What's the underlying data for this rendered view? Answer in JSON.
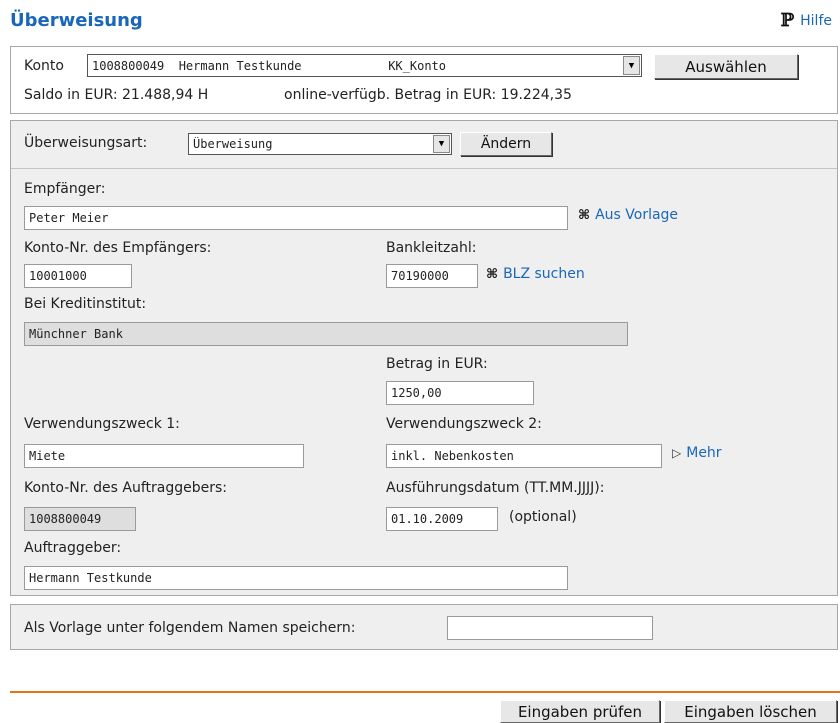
{
  "header": {
    "title": "Überweisung",
    "help_label": "Hilfe"
  },
  "account": {
    "label": "Konto",
    "selected": "1008800049  Hermann Testkunde            KK_Konto",
    "select_button": "Auswählen",
    "saldo": "Saldo in EUR:  21.488,94 H",
    "available": "online-verfügb. Betrag in EUR:  19.224,35"
  },
  "transfer_type": {
    "label": "Überweisungsart:",
    "value": "Überweisung",
    "change_button": "Ändern"
  },
  "form": {
    "recipient_label": "Empfänger:",
    "recipient_value": "Peter Meier",
    "template_link": "Aus Vorlage",
    "recipient_account_label": "Konto-Nr. des Empfängers:",
    "recipient_account_value": "10001000",
    "bank_code_label": "Bankleitzahl:",
    "bank_code_value": "70190000",
    "blz_search_link": "BLZ suchen",
    "institution_label": "Bei Kreditinstitut:",
    "institution_value": "Münchner Bank",
    "amount_label": "Betrag in EUR:",
    "amount_value": "1250,00",
    "purpose1_label": "Verwendungszweck 1:",
    "purpose1_value": "Miete",
    "purpose2_label": "Verwendungszweck 2:",
    "purpose2_value": "inkl. Nebenkosten",
    "more_link": "Mehr",
    "sender_account_label": "Konto-Nr. des Auftraggebers:",
    "sender_account_value": "1008800049",
    "execution_date_label": "Ausführungsdatum (TT.MM.JJJJ):",
    "execution_date_value": "01.10.2009",
    "optional_note": "(optional)",
    "sender_label": "Auftraggeber:",
    "sender_value": "Hermann Testkunde"
  },
  "save_template": {
    "label": "Als Vorlage unter folgendem Namen speichern:",
    "value": ""
  },
  "footer": {
    "check_button": "Eingaben prüfen",
    "clear_button": "Eingaben löschen"
  },
  "colors": {
    "accent": "#1a66b8",
    "panel_bg": "#efefef",
    "divider": "#e8731c"
  }
}
